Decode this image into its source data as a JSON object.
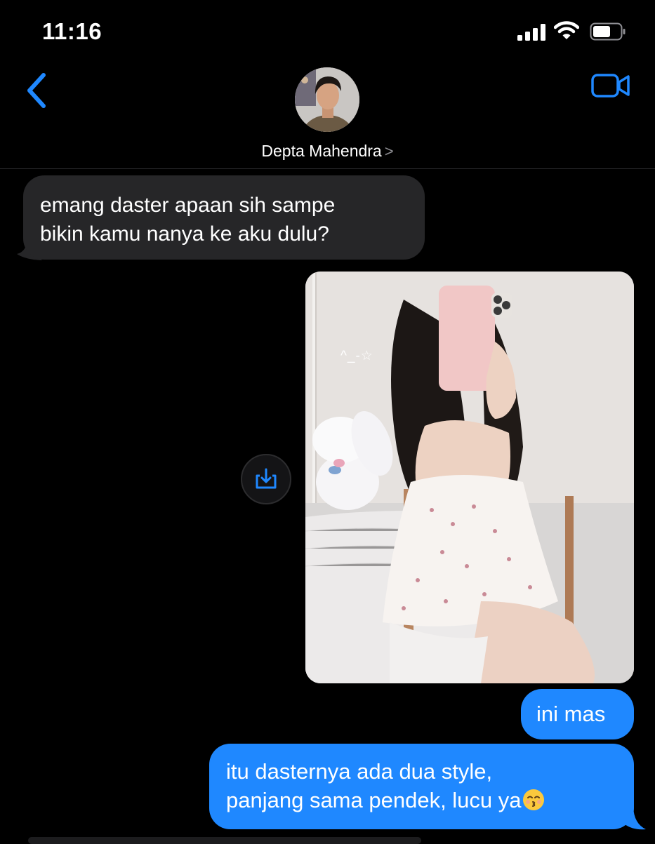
{
  "status_bar": {
    "time": "11:16",
    "icons": [
      "cellular-signal-icon",
      "wifi-icon",
      "battery-icon"
    ]
  },
  "header": {
    "contact_name": "Depta Mahendra",
    "chevron": ">",
    "back_icon": "chevron-left-icon",
    "video_icon": "video-camera-icon",
    "accent_color": "#1F88FF"
  },
  "messages": [
    {
      "direction": "incoming",
      "lines": [
        "emang daster apaan sih sampe",
        "bikin kamu nanya ke aku dulu?"
      ]
    },
    {
      "direction": "outgoing",
      "type": "photo",
      "overlay_text": "^_-☆"
    },
    {
      "direction": "outgoing",
      "lines": [
        "ini mas"
      ]
    },
    {
      "direction": "outgoing",
      "lines": [
        "itu dasternya ada dua style,",
        "panjang sama pendek, lucu ya"
      ],
      "trailing_emoji": "kissing-face-with-closed-eyes"
    }
  ],
  "colors": {
    "background": "#000000",
    "incoming_bubble": "#262628",
    "outgoing_bubble": "#1F88FF"
  }
}
